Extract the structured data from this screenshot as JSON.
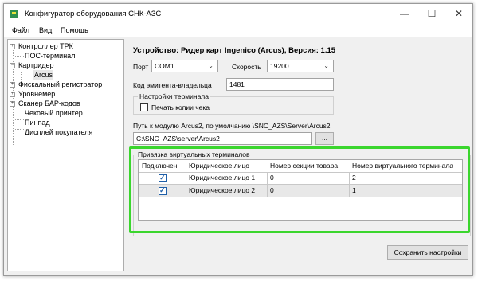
{
  "window": {
    "title": "Конфигуратор оборудования СНК-АЗС"
  },
  "menu": [
    "Файл",
    "Вид",
    "Помощь"
  ],
  "tree": {
    "items": [
      {
        "label": "Контроллер ТРК",
        "expander": "+"
      },
      {
        "label": "ПОС-терминал",
        "expander": ""
      },
      {
        "label": "Картридер",
        "expander": "−"
      },
      {
        "label": "Arcus",
        "expander": ""
      },
      {
        "label": "Фискальный регистратор",
        "expander": "+"
      },
      {
        "label": "Уровнемер",
        "expander": "+"
      },
      {
        "label": "Сканер БАР-кодов",
        "expander": "+"
      },
      {
        "label": "Чековый принтер",
        "expander": ""
      },
      {
        "label": "Пинпад",
        "expander": ""
      },
      {
        "label": "Дисплей покупателя",
        "expander": ""
      }
    ]
  },
  "panel": {
    "title": "Устройство: Ридер карт Ingenico (Arcus), Версия: 1.15",
    "port_label": "Порт",
    "port_value": "COM1",
    "speed_label": "Скорость",
    "speed_value": "19200",
    "issuer_label": "Код эмитента-владельца",
    "issuer_value": "1481",
    "terminal_group": "Настройки терминала",
    "print_copy_label": "Печать копии чека",
    "print_copy_checked": false,
    "path_label": "Путь к модулю Arcus2, по умолчанию \\SNC_AZS\\Server\\Arcus2",
    "path_value": "C:\\SNC_AZS\\server\\Arcus2",
    "browse_label": "...",
    "binding_group": "Привязка виртуальных терминалов",
    "save_label": "Сохранить настройки"
  },
  "table": {
    "columns": [
      "Подключен",
      "Юридическое лицо",
      "Номер секции товара",
      "Номер виртуального терминала"
    ],
    "rows": [
      {
        "connected": true,
        "entity": "Юридическое лицо 1",
        "section": "0",
        "terminal": "2"
      },
      {
        "connected": true,
        "entity": "Юридическое лицо 2",
        "section": "0",
        "terminal": "1"
      }
    ]
  },
  "colors": {
    "highlight": "#3bd62e",
    "check": "#1f5fa8"
  }
}
